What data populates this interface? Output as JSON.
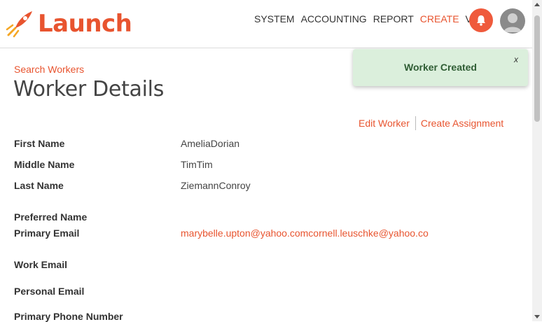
{
  "header": {
    "logo_text": "Launch",
    "nav": [
      "SYSTEM",
      "ACCOUNTING",
      "REPORT",
      "CREATE",
      "VIEW"
    ],
    "active_nav": "CREATE"
  },
  "breadcrumb": "Search Workers",
  "title": "Worker Details",
  "actions": {
    "edit": "Edit Worker",
    "create_assignment": "Create Assignment"
  },
  "toast": {
    "message": "Worker Created",
    "close": "x"
  },
  "fields": [
    {
      "label": "First Name",
      "value": "AmeliaDorian"
    },
    {
      "label": "Middle Name",
      "value": "TimTim"
    },
    {
      "label": "Last Name",
      "value": "ZiemannConroy"
    },
    {
      "label": "Preferred Name",
      "value": ""
    },
    {
      "label": "Primary Email",
      "value": "marybelle.upton@yahoo.comcornell.leuschke@yahoo.co"
    },
    {
      "label": "Work Email",
      "value": ""
    },
    {
      "label": "Personal Email",
      "value": ""
    },
    {
      "label": "Primary Phone Number",
      "value": ""
    }
  ],
  "colors": {
    "accent": "#e8542f",
    "toast_bg": "#dbefdc",
    "toast_text": "#2f5d34"
  }
}
